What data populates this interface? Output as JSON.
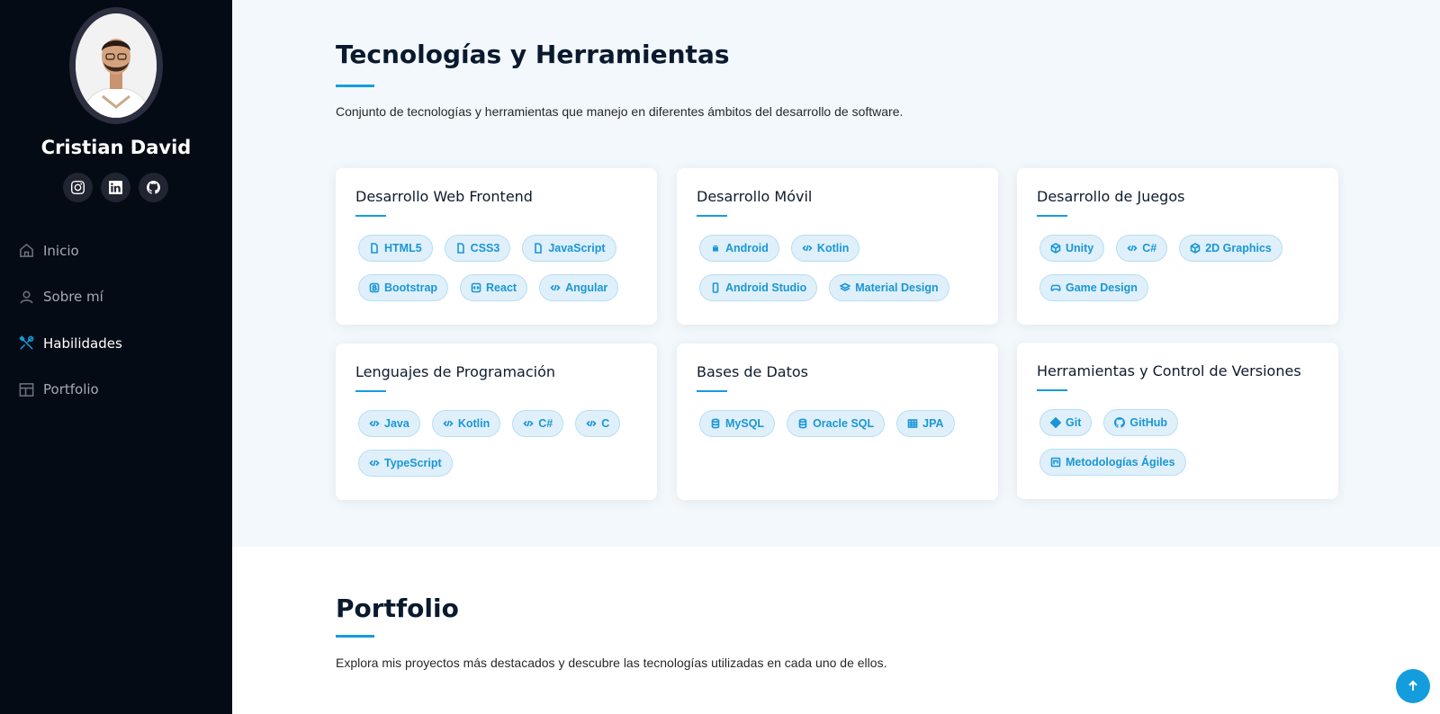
{
  "profile": {
    "name": "Cristian David",
    "socials": [
      {
        "icon": "instagram-icon"
      },
      {
        "icon": "linkedin-icon"
      },
      {
        "icon": "github-icon"
      }
    ]
  },
  "nav": {
    "items": [
      {
        "label": "Inicio",
        "icon": "home-icon",
        "active": false
      },
      {
        "label": "Sobre mí",
        "icon": "person-icon",
        "active": false
      },
      {
        "label": "Habilidades",
        "icon": "tools-icon",
        "active": true
      },
      {
        "label": "Portfolio",
        "icon": "layout-icon",
        "active": false
      }
    ]
  },
  "skills": {
    "title": "Tecnologías y Herramientas",
    "description": "Conjunto de tecnologías y herramientas que manejo en diferentes ámbitos del desarrollo de software.",
    "cards": [
      {
        "title": "Desarrollo Web Frontend",
        "badges": [
          {
            "label": "HTML5",
            "icon": "file-icon"
          },
          {
            "label": "CSS3",
            "icon": "file-icon"
          },
          {
            "label": "JavaScript",
            "icon": "file-icon"
          },
          {
            "label": "Bootstrap",
            "icon": "bootstrap-icon"
          },
          {
            "label": "React",
            "icon": "code-square-icon"
          },
          {
            "label": "Angular",
            "icon": "code-icon"
          }
        ]
      },
      {
        "title": "Desarrollo Móvil",
        "badges": [
          {
            "label": "Android",
            "icon": "android-icon"
          },
          {
            "label": "Kotlin",
            "icon": "code-icon"
          },
          {
            "label": "Android Studio",
            "icon": "phone-icon"
          },
          {
            "label": "Material Design",
            "icon": "layers-icon"
          }
        ]
      },
      {
        "title": "Desarrollo de Juegos",
        "badges": [
          {
            "label": "Unity",
            "icon": "unity-icon"
          },
          {
            "label": "C#",
            "icon": "code-icon"
          },
          {
            "label": "2D Graphics",
            "icon": "box-icon"
          },
          {
            "label": "Game Design",
            "icon": "controller-icon"
          }
        ]
      },
      {
        "title": "Lenguajes de Programación",
        "badges": [
          {
            "label": "Java",
            "icon": "code-icon"
          },
          {
            "label": "Kotlin",
            "icon": "code-icon"
          },
          {
            "label": "C#",
            "icon": "code-icon"
          },
          {
            "label": "C",
            "icon": "code-icon"
          },
          {
            "label": "TypeScript",
            "icon": "code-icon"
          }
        ]
      },
      {
        "title": "Bases de Datos",
        "badges": [
          {
            "label": "MySQL",
            "icon": "database-icon"
          },
          {
            "label": "Oracle SQL",
            "icon": "database-icon"
          },
          {
            "label": "JPA",
            "icon": "table-icon"
          }
        ]
      },
      {
        "title": "Herramientas y Control de Versiones",
        "badges": [
          {
            "label": "Git",
            "icon": "git-icon"
          },
          {
            "label": "GitHub",
            "icon": "github-icon"
          },
          {
            "label": "Metodologías Ágiles",
            "icon": "kanban-icon"
          }
        ]
      }
    ]
  },
  "portfolio": {
    "title": "Portfolio",
    "description": "Explora mis proyectos más destacados y descubre las tecnologías utilizadas en cada uno de ellos."
  },
  "scroll_top": {
    "icon": "arrow-up-icon"
  },
  "colors": {
    "accent": "#149ddd",
    "sidebar": "#040b14"
  }
}
